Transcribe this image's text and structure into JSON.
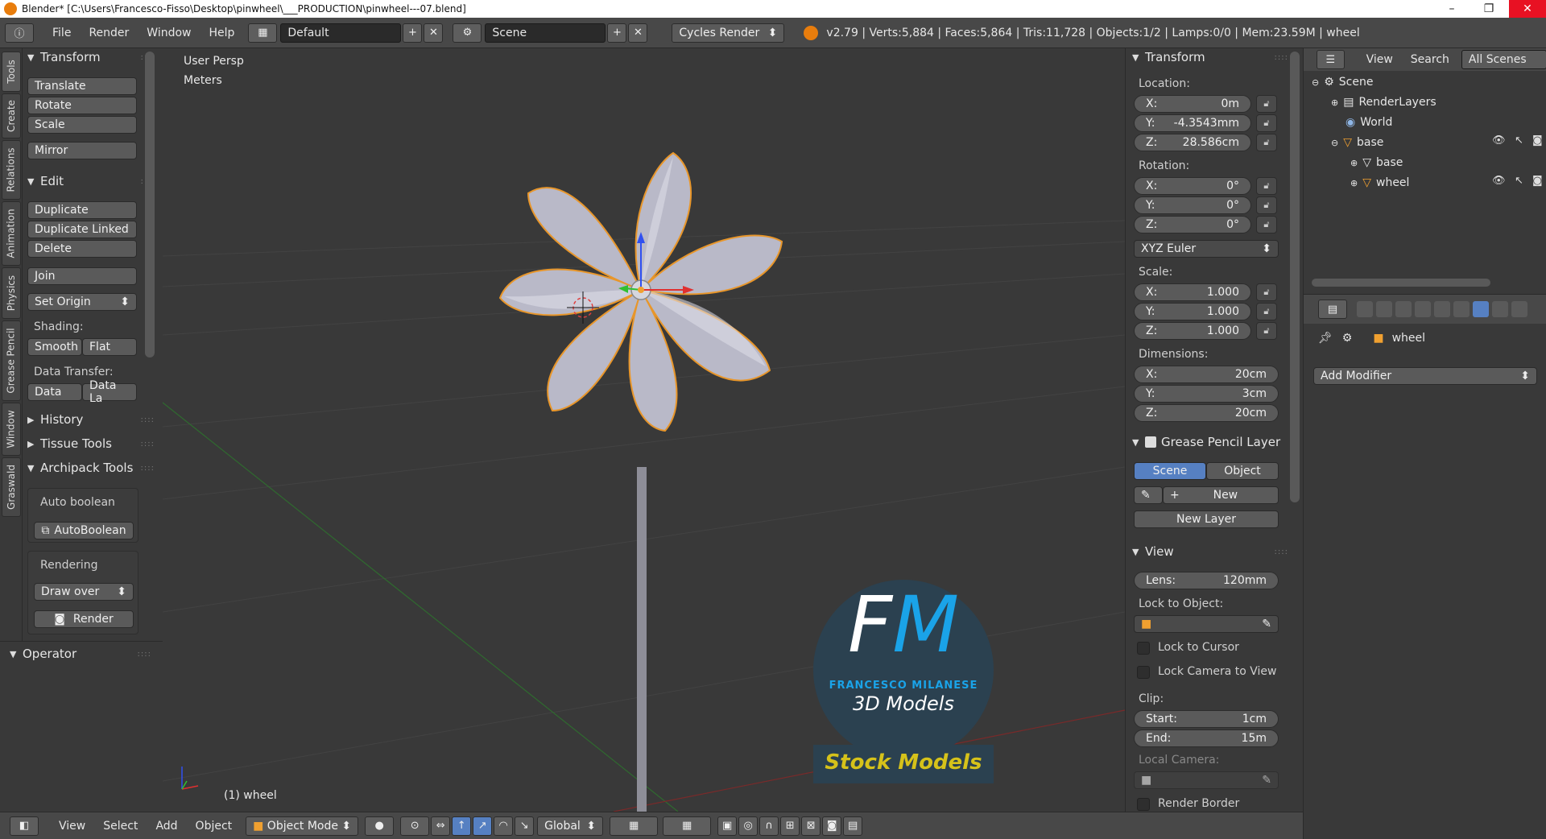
{
  "window": {
    "title": "Blender* [C:\\Users\\Francesco-Fisso\\Desktop\\pinwheel\\___PRODUCTION\\pinwheel---07.blend]",
    "minimize": "–",
    "maximize": "❐",
    "close": "✕"
  },
  "menubar": {
    "items": [
      "File",
      "Render",
      "Window",
      "Help"
    ],
    "layout": "Default",
    "scene": "Scene",
    "engine": "Cycles Render",
    "stats": "v2.79 | Verts:5,884 | Faces:5,864 | Tris:11,728 | Objects:1/2 | Lamps:0/0 | Mem:23.59M | wheel"
  },
  "tool_tabs": [
    "Tools",
    "Create",
    "Relations",
    "Animation",
    "Physics",
    "Grease Pencil",
    "Window",
    "Graswald"
  ],
  "tools": {
    "transform_header": "Transform",
    "translate": "Translate",
    "rotate": "Rotate",
    "scale": "Scale",
    "mirror": "Mirror",
    "edit_header": "Edit",
    "duplicate": "Duplicate",
    "duplicate_linked": "Duplicate Linked",
    "delete": "Delete",
    "join": "Join",
    "set_origin": "Set Origin",
    "shading_label": "Shading:",
    "smooth": "Smooth",
    "flat": "Flat",
    "data_transfer_label": "Data Transfer:",
    "data": "Data",
    "data_la": "Data La",
    "history": "History",
    "tissue": "Tissue Tools",
    "archipack": "Archipack Tools",
    "auto_boolean_label": "Auto boolean",
    "auto_boolean_btn": "AutoBoolean",
    "rendering_label": "Rendering",
    "draw_over": "Draw over",
    "render_btn": "Render",
    "operator": "Operator"
  },
  "viewport": {
    "view_name": "User Persp",
    "units": "Meters",
    "object_label": "(1) wheel",
    "logo_letters": "FM",
    "logo_name": "FRANCESCO MILANESE",
    "logo_sub": "3D Models",
    "logo_banner": "Stock Models"
  },
  "viewport_header": {
    "view": "View",
    "select": "Select",
    "add": "Add",
    "object": "Object",
    "mode": "Object Mode",
    "orientation": "Global"
  },
  "npanel": {
    "transform_header": "Transform",
    "location_label": "Location:",
    "loc": [
      {
        "axis": "X:",
        "value": "0m"
      },
      {
        "axis": "Y:",
        "value": "-4.3543mm"
      },
      {
        "axis": "Z:",
        "value": "28.586cm"
      }
    ],
    "rotation_label": "Rotation:",
    "rot": [
      {
        "axis": "X:",
        "value": "0°"
      },
      {
        "axis": "Y:",
        "value": "0°"
      },
      {
        "axis": "Z:",
        "value": "0°"
      }
    ],
    "rot_mode": "XYZ Euler",
    "scale_label": "Scale:",
    "scale": [
      {
        "axis": "X:",
        "value": "1.000"
      },
      {
        "axis": "Y:",
        "value": "1.000"
      },
      {
        "axis": "Z:",
        "value": "1.000"
      }
    ],
    "dimensions_label": "Dimensions:",
    "dim": [
      {
        "axis": "X:",
        "value": "20cm"
      },
      {
        "axis": "Y:",
        "value": "3cm"
      },
      {
        "axis": "Z:",
        "value": "20cm"
      }
    ],
    "gp_header": "Grease Pencil Layer",
    "gp_scene": "Scene",
    "gp_object": "Object",
    "gp_new": "New",
    "gp_new_layer": "New Layer",
    "view_header": "View",
    "lens_label": "Lens:",
    "lens_value": "120mm",
    "lock_object_label": "Lock to Object:",
    "lock_cursor": "Lock to Cursor",
    "lock_camera": "Lock Camera to View",
    "clip_label": "Clip:",
    "clip_start_label": "Start:",
    "clip_start": "1cm",
    "clip_end_label": "End:",
    "clip_end": "15m",
    "local_camera": "Local Camera:",
    "render_border": "Render Border"
  },
  "outliner": {
    "view": "View",
    "search": "Search",
    "filter": "All Scenes",
    "rows": [
      "Scene",
      "RenderLayers",
      "World",
      "base",
      "base",
      "wheel"
    ]
  },
  "properties": {
    "object_name": "wheel",
    "add_modifier": "Add Modifier"
  },
  "colors": {
    "accent": "#5680c2",
    "selection": "#f0a030",
    "logo_blue": "#1aa3e8",
    "banner_yellow": "#d6c21a"
  }
}
